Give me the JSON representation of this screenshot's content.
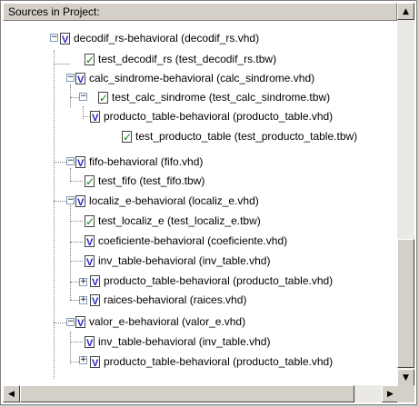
{
  "header": {
    "title": "Sources in Project:"
  },
  "tree": [
    {
      "label": "decodif_rs-behavioral (decodif_rs.vhd)",
      "icon": "vhdl-file-icon"
    },
    {
      "label": "test_decodif_rs (test_decodif_rs.tbw)",
      "icon": "testbench-check-icon"
    },
    {
      "label": "calc_sindrome-behavioral (calc_sindrome.vhd)",
      "icon": "vhdl-file-icon"
    },
    {
      "label": "test_calc_sindrome (test_calc_sindrome.tbw)",
      "icon": "testbench-check-icon"
    },
    {
      "label": "producto_table-behavioral (producto_table.vhd)",
      "icon": "vhdl-file-icon"
    },
    {
      "label": "test_producto_table (test_producto_table.tbw)",
      "icon": "testbench-check-icon"
    },
    {
      "label": "fifo-behavioral (fifo.vhd)",
      "icon": "vhdl-file-icon"
    },
    {
      "label": "test_fifo (test_fifo.tbw)",
      "icon": "testbench-check-icon"
    },
    {
      "label": "localiz_e-behavioral (localiz_e.vhd)",
      "icon": "vhdl-file-icon"
    },
    {
      "label": "test_localiz_e (test_localiz_e.tbw)",
      "icon": "testbench-check-icon"
    },
    {
      "label": "coeficiente-behavioral (coeficiente.vhd)",
      "icon": "vhdl-file-icon"
    },
    {
      "label": "inv_table-behavioral (inv_table.vhd)",
      "icon": "vhdl-file-icon"
    },
    {
      "label": "producto_table-behavioral (producto_table.vhd)",
      "icon": "vhdl-file-icon"
    },
    {
      "label": "raices-behavioral (raices.vhd)",
      "icon": "vhdl-file-icon"
    },
    {
      "label": "valor_e-behavioral (valor_e.vhd)",
      "icon": "vhdl-file-icon"
    },
    {
      "label": "inv_table-behavioral (inv_table.vhd)",
      "icon": "vhdl-file-icon"
    },
    {
      "label": "producto_table-behavioral (producto_table.vhd)",
      "icon": "vhdl-file-icon"
    }
  ],
  "scrollbar": {
    "up_icon": "scroll-up-arrow-icon",
    "down_icon": "scroll-down-arrow-icon",
    "left_icon": "scroll-left-arrow-icon",
    "right_icon": "scroll-right-arrow-icon"
  }
}
